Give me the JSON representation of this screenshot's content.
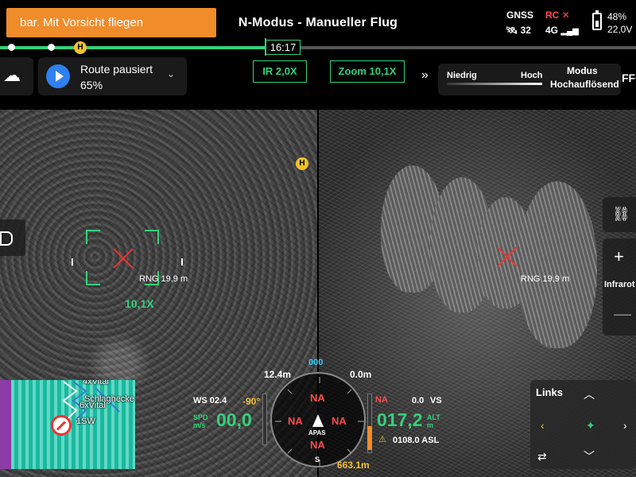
{
  "warning": {
    "text": "bar. Mit Vorsicht fliegen"
  },
  "header": {
    "mode_title": "N-Modus - Manueller Flug",
    "gnss": {
      "label": "GNSS",
      "satellites": "32"
    },
    "rc": {
      "label": "RC ✕",
      "network": "4G"
    },
    "battery": {
      "percent": "48%",
      "voltage": "22,0V"
    }
  },
  "timeline": {
    "time": "16:17",
    "home_label": "H",
    "progress": 0.42
  },
  "route": {
    "status": "Route pausiert",
    "progress": "65%"
  },
  "zoom": {
    "ir": "IR  2,0X",
    "main": "Zoom  10,1X"
  },
  "mode_panel": {
    "low": "Niedrig",
    "high": "Hoch",
    "label": "Modus",
    "value": "Hochauflösend",
    "ffc": "FFC"
  },
  "left_feed": {
    "range": "RNG 19,9 m",
    "zoom": "10,1X",
    "home_label": "H"
  },
  "right_feed": {
    "range": "RNG 19,9 m",
    "ir_label": "Infrarot",
    "plus": "+",
    "minus": "—"
  },
  "minimap": {
    "labels": [
      "4xVital",
      "Schlaghecke",
      "6xVital",
      "1SW"
    ]
  },
  "hud": {
    "height": "12.4m",
    "heading": "000",
    "dist": "0.0m",
    "ws": "WS 02.4",
    "wind_dir": "-90°",
    "spd_label": "SPD\nm/s",
    "speed": "00,0",
    "na": "NA",
    "apas": "APAS",
    "south": "S",
    "alt_value": "017,2",
    "alt_label": "ALT\nm",
    "vs_value": "0.0",
    "vs_label": "VS",
    "asl": "0108.0 ASL",
    "distance": "663.1m",
    "alt_na": "NA"
  },
  "control": {
    "label": "Links"
  }
}
